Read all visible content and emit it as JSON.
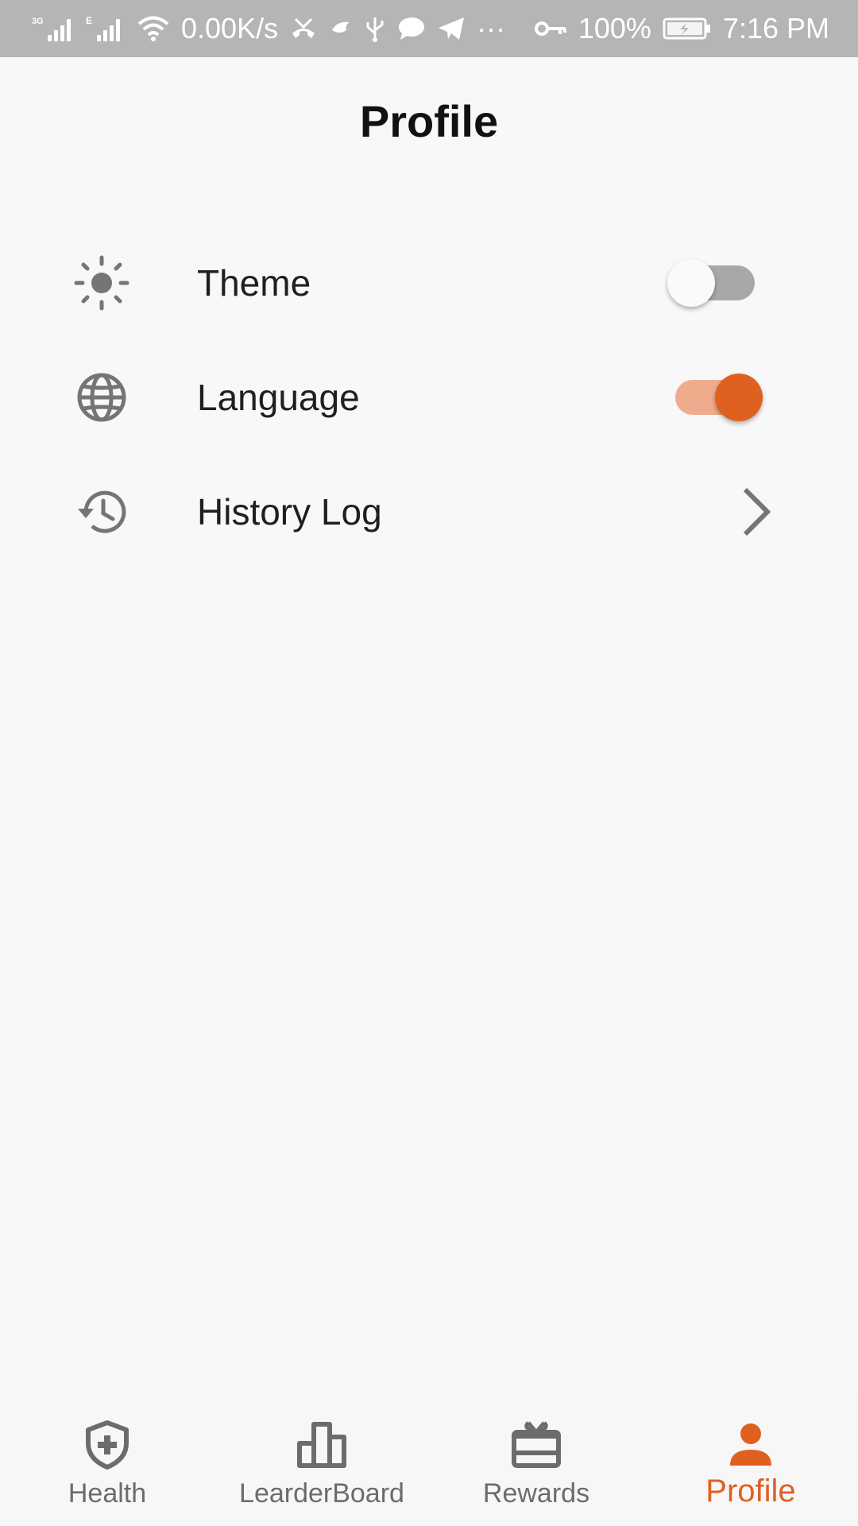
{
  "status_bar": {
    "network_3g": "3G",
    "network_e": "E",
    "speed": "0.00K/s",
    "battery": "100%",
    "time": "7:16 PM",
    "more": "···"
  },
  "header": {
    "title": "Profile"
  },
  "settings": [
    {
      "icon": "sun-icon",
      "label": "Theme",
      "control": "switch",
      "on": false
    },
    {
      "icon": "globe-icon",
      "label": "Language",
      "control": "switch",
      "on": true
    },
    {
      "icon": "history-icon",
      "label": "History Log",
      "control": "chevron"
    }
  ],
  "bottom_nav": {
    "items": [
      {
        "icon": "shield-plus-icon",
        "label": "Health",
        "active": false
      },
      {
        "icon": "leaderboard-icon",
        "label": "LearderBoard",
        "active": false
      },
      {
        "icon": "gift-card-icon",
        "label": "Rewards",
        "active": false
      },
      {
        "icon": "person-icon",
        "label": "Profile",
        "active": true
      }
    ]
  },
  "colors": {
    "accent": "#e06020",
    "accent_track": "#efab8c",
    "status_bar": "#b5b5b5",
    "icon_gray": "#757575",
    "background": "#f8f8f8"
  }
}
